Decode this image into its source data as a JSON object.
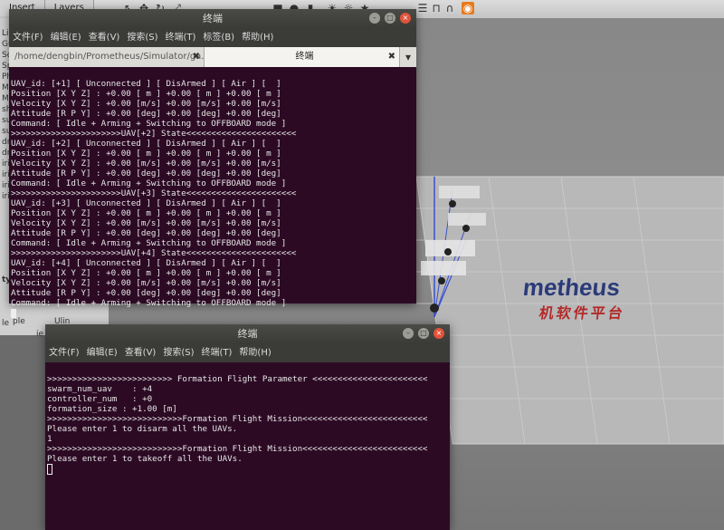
{
  "gazebo": {
    "tabs": [
      "Insert",
      "Layers"
    ],
    "left_panel_texts": [
      "Li",
      "Gu",
      "Sc",
      "Sp",
      "Ph",
      "Ma",
      "Mo",
      "sh",
      "su",
      "su",
      "dr",
      "dr",
      "iris",
      "iris",
      "iris",
      "iris",
      "ty",
      "le",
      "ie"
    ],
    "left_bottom_labels": [
      "ple",
      "Ulin"
    ],
    "logo_text": "metheus",
    "logo_sub": "机软件平台"
  },
  "terminal1": {
    "title": "终端",
    "menu": [
      "文件(F)",
      "编辑(E)",
      "查看(V)",
      "搜索(S)",
      "终端(T)",
      "标签(B)",
      "帮助(H)"
    ],
    "tabs": [
      {
        "label": "/home/dengbin/Prometheus/Simulator/ga..."
      },
      {
        "label": "终端"
      }
    ],
    "lines": [
      "UAV_id: [+1] [ Unconnected ] [ DisArmed ] [ Air ] [  ]",
      "Position [X Y Z] : +0.00 [ m ] +0.00 [ m ] +0.00 [ m ]",
      "Velocity [X Y Z] : +0.00 [m/s] +0.00 [m/s] +0.00 [m/s]",
      "Attitude [R P Y] : +0.00 [deg] +0.00 [deg] +0.00 [deg]",
      "Command: [ Idle + Arming + Switching to OFFBOARD mode ]",
      ">>>>>>>>>>>>>>>>>>>>>>UAV[+2] State<<<<<<<<<<<<<<<<<<<<<<",
      "UAV_id: [+2] [ Unconnected ] [ DisArmed ] [ Air ] [  ]",
      "Position [X Y Z] : +0.00 [ m ] +0.00 [ m ] +0.00 [ m ]",
      "Velocity [X Y Z] : +0.00 [m/s] +0.00 [m/s] +0.00 [m/s]",
      "Attitude [R P Y] : +0.00 [deg] +0.00 [deg] +0.00 [deg]",
      "Command: [ Idle + Arming + Switching to OFFBOARD mode ]",
      ">>>>>>>>>>>>>>>>>>>>>>UAV[+3] State<<<<<<<<<<<<<<<<<<<<<<",
      "UAV_id: [+3] [ Unconnected ] [ DisArmed ] [ Air ] [  ]",
      "Position [X Y Z] : +0.00 [ m ] +0.00 [ m ] +0.00 [ m ]",
      "Velocity [X Y Z] : +0.00 [m/s] +0.00 [m/s] +0.00 [m/s]",
      "Attitude [R P Y] : +0.00 [deg] +0.00 [deg] +0.00 [deg]",
      "Command: [ Idle + Arming + Switching to OFFBOARD mode ]",
      ">>>>>>>>>>>>>>>>>>>>>>UAV[+4] State<<<<<<<<<<<<<<<<<<<<<<",
      "UAV_id: [+4] [ Unconnected ] [ DisArmed ] [ Air ] [  ]",
      "Position [X Y Z] : +0.00 [ m ] +0.00 [ m ] +0.00 [ m ]",
      "Velocity [X Y Z] : +0.00 [m/s] +0.00 [m/s] +0.00 [m/s]",
      "Attitude [R P Y] : +0.00 [deg] +0.00 [deg] +0.00 [deg]",
      "Command: [ Idle + Arming + Switching to OFFBOARD mode ]"
    ]
  },
  "terminal2": {
    "title": "终端",
    "menu": [
      "文件(F)",
      "编辑(E)",
      "查看(V)",
      "搜索(S)",
      "终端(T)",
      "帮助(H)"
    ],
    "lines": [
      ">>>>>>>>>>>>>>>>>>>>>>>>> Formation Flight Parameter <<<<<<<<<<<<<<<<<<<<<<<",
      "swarm_num_uav    : +4",
      "controller_num   : +0",
      "formation_size : +1.00 [m]",
      ">>>>>>>>>>>>>>>>>>>>>>>>>>>Formation Flight Mission<<<<<<<<<<<<<<<<<<<<<<<<<",
      "Please enter 1 to disarm all the UAVs.",
      "1",
      ">>>>>>>>>>>>>>>>>>>>>>>>>>>Formation Flight Mission<<<<<<<<<<<<<<<<<<<<<<<<<",
      "Please enter 1 to takeoff all the UAVs."
    ]
  }
}
